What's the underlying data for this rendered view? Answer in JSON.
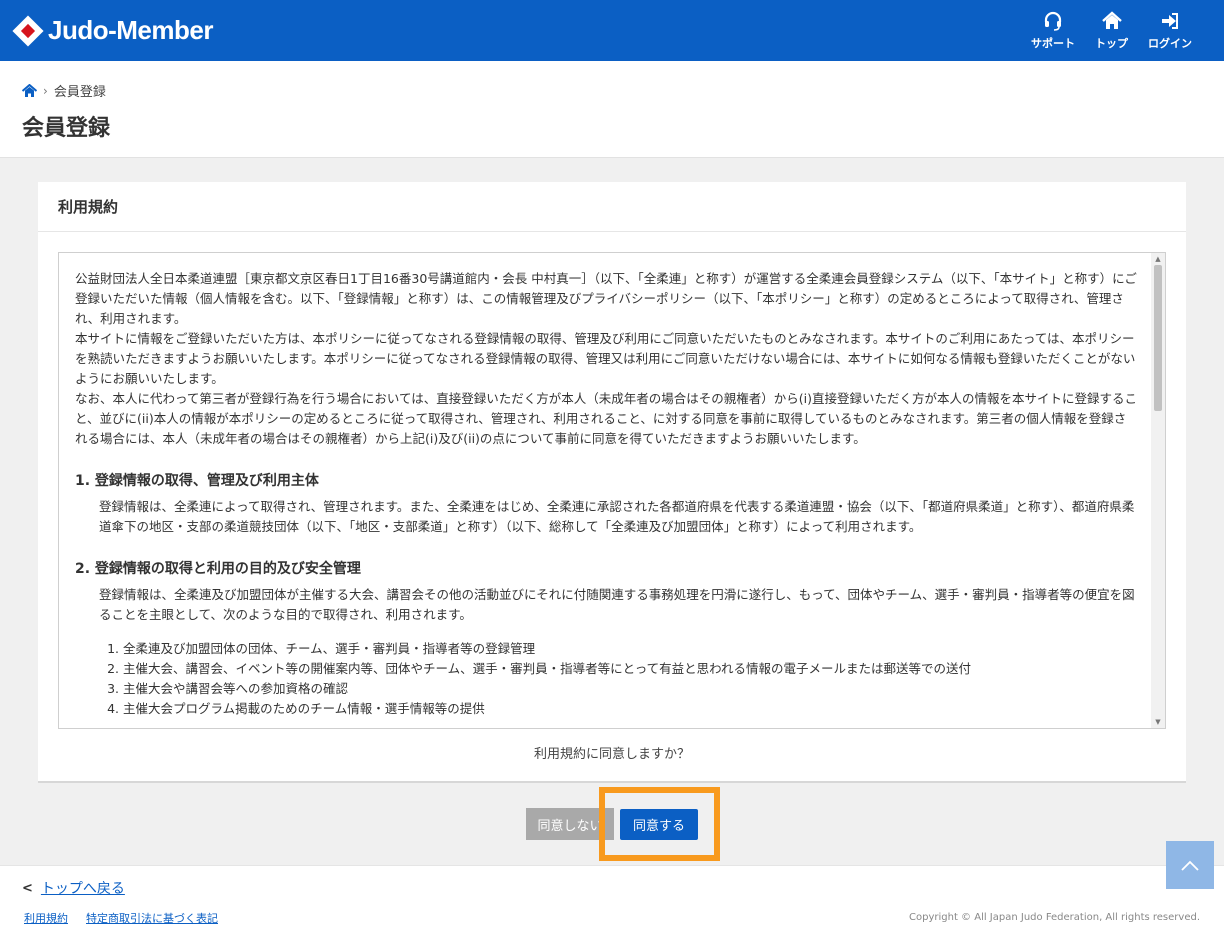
{
  "header": {
    "logo_text": "Judo-Member",
    "nav": [
      {
        "label": "サポート",
        "icon": "headset-icon"
      },
      {
        "label": "トップ",
        "icon": "home-icon"
      },
      {
        "label": "ログイン",
        "icon": "login-icon"
      }
    ]
  },
  "breadcrumb": {
    "current": "会員登録"
  },
  "page_title": "会員登録",
  "card": {
    "title": "利用規約",
    "intro": [
      "公益財団法人全日本柔道連盟［東京都文京区春日1丁目16番30号講道館内・会長 中村真一］（以下、「全柔連」と称す）が運営する全柔連会員登録システム（以下、「本サイト」と称す）にご登録いただいた情報（個人情報を含む。以下、「登録情報」と称す）は、この情報管理及びプライバシーポリシー（以下、「本ポリシー」と称す）の定めるところによって取得され、管理され、利用されます。",
      "本サイトに情報をご登録いただいた方は、本ポリシーに従ってなされる登録情報の取得、管理及び利用にご同意いただいたものとみなされます。本サイトのご利用にあたっては、本ポリシーを熟読いただきますようお願いいたします。本ポリシーに従ってなされる登録情報の取得、管理又は利用にご同意いただけない場合には、本サイトに如何なる情報も登録いただくことがないようにお願いいたします。",
      "なお、本人に代わって第三者が登録行為を行う場合においては、直接登録いただく方が本人（未成年者の場合はその親権者）から(i)直接登録いただく方が本人の情報を本サイトに登録すること、並びに(ii)本人の情報が本ポリシーの定めるところに従って取得され、管理され、利用されること、に対する同意を事前に取得しているものとみなされます。第三者の個人情報を登録される場合には、本人（未成年者の場合はその親権者）から上記(i)及び(ii)の点について事前に同意を得ていただきますようお願いいたします。"
    ],
    "section1": {
      "heading": "1.  登録情報の取得、管理及び利用主体",
      "body": "登録情報は、全柔連によって取得され、管理されます。また、全柔連をはじめ、全柔連に承認された各都道府県を代表する柔道連盟・協会（以下、「都道府県柔道」と称す）、都道府県柔道傘下の地区・支部の柔道競技団体（以下、「地区・支部柔道」と称す）（以下、総称して「全柔連及び加盟団体」と称す）によって利用されます。"
    },
    "section2": {
      "heading": "2.  登録情報の取得と利用の目的及び安全管理",
      "body": "登録情報は、全柔連及び加盟団体が主催する大会、講習会その他の活動並びにそれに付随関連する事務処理を円滑に遂行し、もって、団体やチーム、選手・審判員・指導者等の便宜を図ることを主眼として、次のような目的で取得され、利用されます。",
      "items": [
        "全柔連及び加盟団体の団体、チーム、選手・審判員・指導者等の登録管理",
        "主催大会、講習会、イベント等の開催案内等、団体やチーム、選手・審判員・指導者等にとって有益と思われる情報の電子メールまたは郵送等での送付",
        "主催大会や講習会等への参加資格の確認",
        "主催大会プログラム掲載のためのチーム情報・選手情報等の提供"
      ]
    },
    "question": "利用規約に同意しますか？"
  },
  "buttons": {
    "disagree": "同意しない",
    "agree": "同意する"
  },
  "footer": {
    "back": "トップへ戻る",
    "links": [
      "利用規約",
      "特定商取引法に基づく表記"
    ],
    "copyright": "Copyright © All Japan Judo Federation, All rights reserved."
  },
  "colors": {
    "primary": "#0b5fc4",
    "highlight": "#f89a1e",
    "disabled": "#a9a9a9"
  }
}
